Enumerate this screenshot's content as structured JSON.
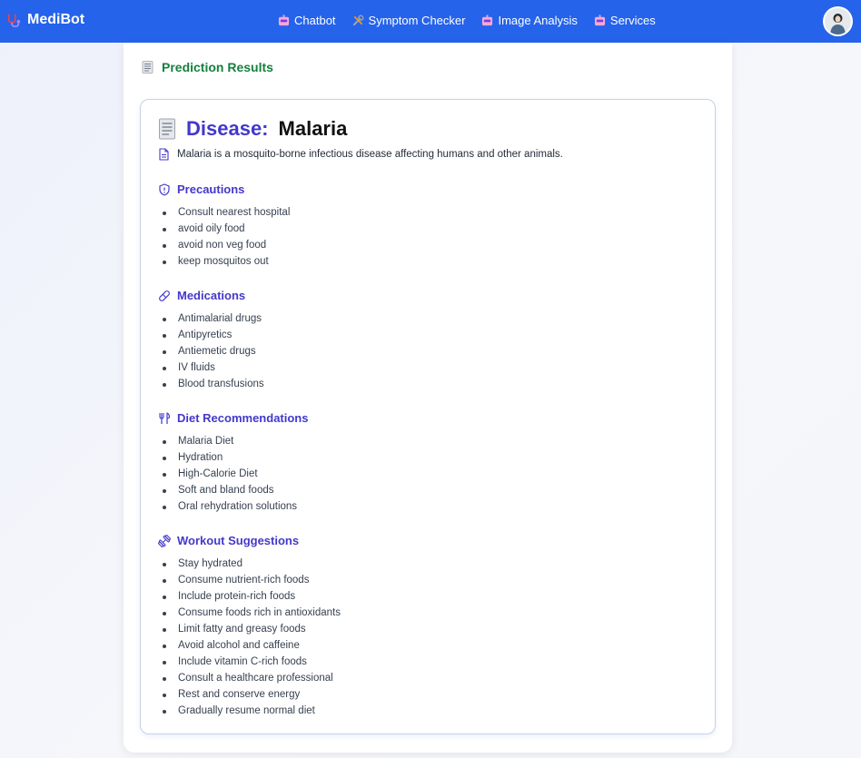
{
  "nav": {
    "brand": "MediBot",
    "brand_icon": "stethoscope-icon",
    "items": [
      {
        "label": "Chatbot",
        "icon": "robot-icon"
      },
      {
        "label": "Symptom Checker",
        "icon": "tools-icon"
      },
      {
        "label": "Image Analysis",
        "icon": "robot-icon"
      },
      {
        "label": "Services",
        "icon": "robot-icon"
      }
    ],
    "accent_color": "#2563eb"
  },
  "results": {
    "title": "Prediction Results",
    "disease_label": "Disease:",
    "disease_name": "Malaria",
    "description": "Malaria is a mosquito-borne infectious disease affecting humans and other animals.",
    "sections": [
      {
        "title": "Precautions",
        "icon": "shield-icon",
        "items": [
          "Consult nearest hospital",
          "avoid oily food",
          "avoid non veg food",
          "keep mosquitos out"
        ]
      },
      {
        "title": "Medications",
        "icon": "pill-icon",
        "items": [
          "Antimalarial drugs",
          "Antipyretics",
          "Antiemetic drugs",
          "IV fluids",
          "Blood transfusions"
        ]
      },
      {
        "title": "Diet Recommendations",
        "icon": "utensils-icon",
        "items": [
          "Malaria Diet",
          "Hydration",
          "High-Calorie Diet",
          "Soft and bland foods",
          "Oral rehydration solutions"
        ]
      },
      {
        "title": "Workout Suggestions",
        "icon": "dumbbell-icon",
        "items": [
          "Stay hydrated",
          "Consume nutrient-rich foods",
          "Include protein-rich foods",
          "Consume foods rich in antioxidants",
          "Limit fatty and greasy foods",
          "Avoid alcohol and caffeine",
          "Include vitamin C-rich foods",
          "Consult a healthcare professional",
          "Rest and conserve energy",
          "Gradually resume normal diet"
        ]
      }
    ]
  }
}
